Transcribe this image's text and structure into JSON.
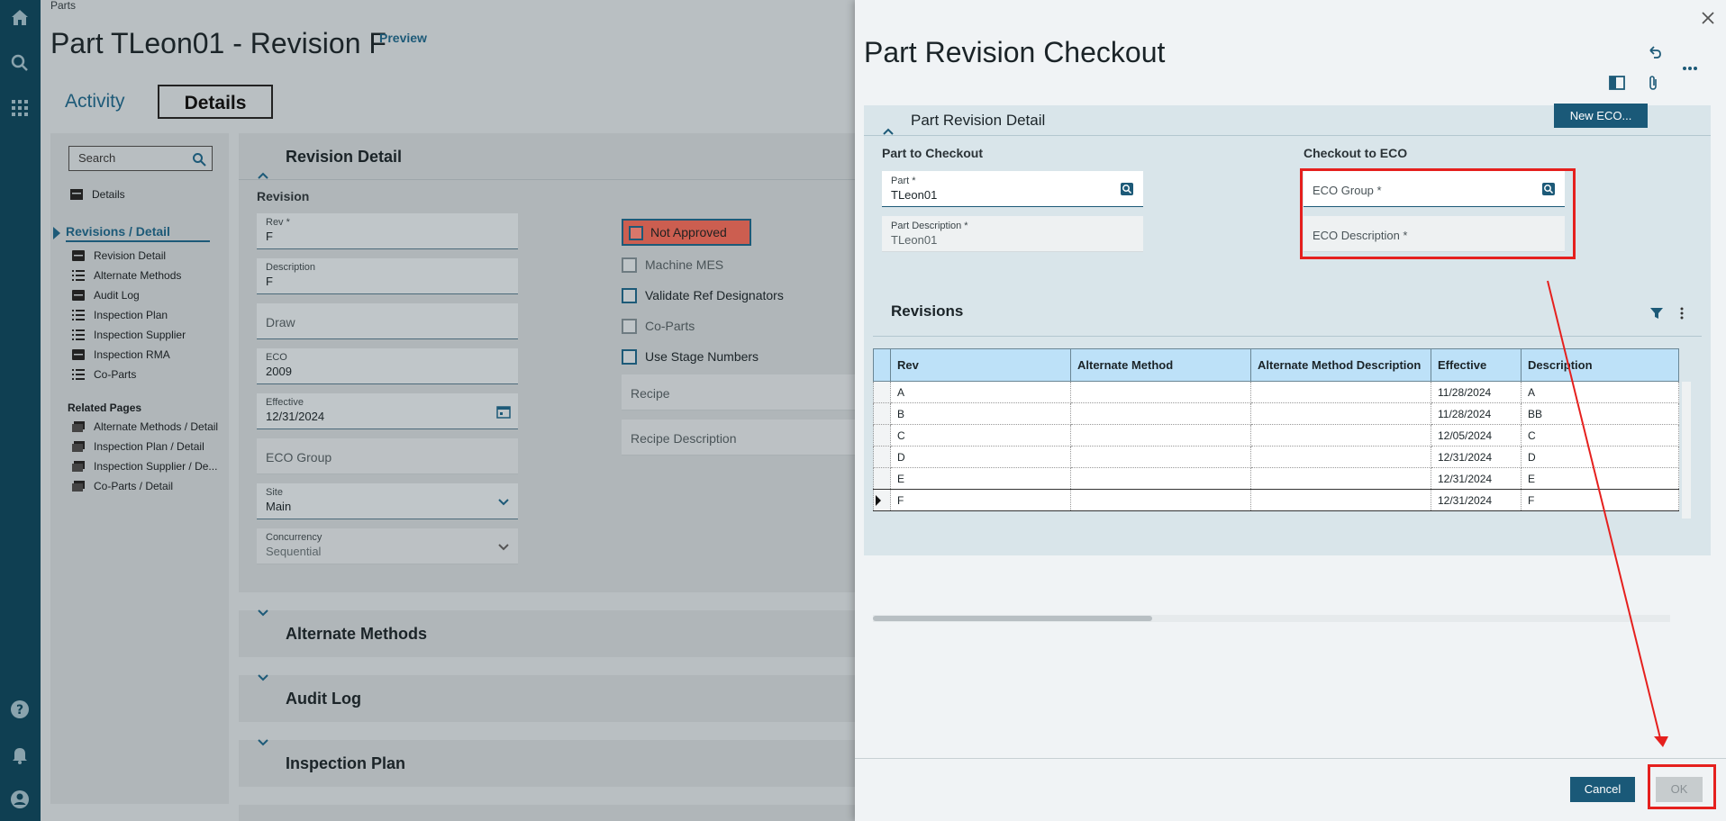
{
  "background": {
    "breadcrumb": "Parts",
    "title": "Part TLeon01 - Revision F",
    "preview": "Preview",
    "tabs": {
      "activity": "Activity",
      "details": "Details"
    },
    "search_placeholder": "Search",
    "nav": {
      "details": "Details",
      "selected": "Revisions / Detail",
      "items": [
        "Revision Detail",
        "Alternate Methods",
        "Audit Log",
        "Inspection Plan",
        "Inspection Supplier",
        "Inspection RMA",
        "Co-Parts"
      ],
      "related_heading": "Related Pages",
      "related": [
        "Alternate Methods / Detail",
        "Inspection Plan / Detail",
        "Inspection Supplier / De...",
        "Co-Parts / Detail"
      ]
    },
    "section": "Revision Detail",
    "sub_label": "Revision",
    "fields": {
      "rev_label": "Rev *",
      "rev_value": "F",
      "desc_label": "Description",
      "desc_value": "F",
      "draw_label": "Draw",
      "eco_label": "ECO",
      "eco_value": "2009",
      "eff_label": "Effective",
      "eff_value": "12/31/2024",
      "ecogroup_label": "ECO Group",
      "site_label": "Site",
      "site_value": "Main",
      "conc_label": "Concurrency",
      "conc_value": "Sequential",
      "recipe_label": "Recipe",
      "recipe_desc_label": "Recipe Description"
    },
    "status": "Not Approved",
    "checks": [
      "Machine MES",
      "Validate Ref Designators",
      "Co-Parts",
      "Use Stage Numbers"
    ],
    "collapsed": [
      "Alternate Methods",
      "Audit Log",
      "Inspection Plan"
    ]
  },
  "dialog": {
    "title": "Part Revision Checkout",
    "card_title": "Part Revision Detail",
    "new_eco": "New ECO...",
    "part_to_checkout": "Part to Checkout",
    "checkout_to_eco": "Checkout to ECO",
    "part_label": "Part *",
    "part_value": "TLeon01",
    "part_desc_label": "Part Description *",
    "part_desc_value": "TLeon01",
    "eco_group_label": "ECO Group *",
    "eco_desc_label": "ECO Description *",
    "grid_title": "Revisions",
    "columns": [
      "Rev",
      "Alternate Method",
      "Alternate Method Description",
      "Effective",
      "Description"
    ],
    "rows": [
      [
        "A",
        "",
        "",
        "11/28/2024",
        "A"
      ],
      [
        "B",
        "",
        "",
        "11/28/2024",
        "BB"
      ],
      [
        "C",
        "",
        "",
        "12/05/2024",
        "C"
      ],
      [
        "D",
        "",
        "",
        "12/31/2024",
        "D"
      ],
      [
        "E",
        "",
        "",
        "12/31/2024",
        "E"
      ],
      [
        "F",
        "",
        "",
        "12/31/2024",
        "F"
      ]
    ],
    "cancel": "Cancel",
    "ok": "OK"
  },
  "colors": {
    "accent": "#1a5978",
    "highlight": "#e5201e",
    "status_bad": "#cc5e50"
  }
}
